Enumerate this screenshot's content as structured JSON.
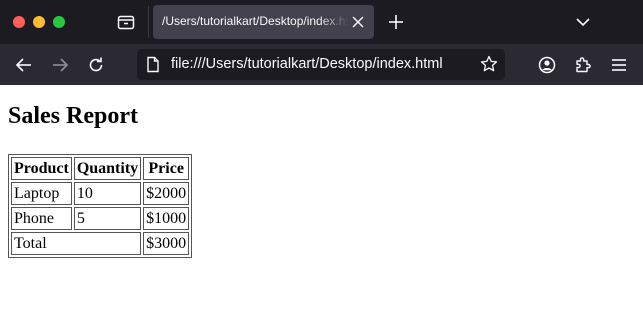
{
  "browser": {
    "tab": {
      "title": "/Users/tutorialkart/Desktop/index.html"
    },
    "url": "file:///Users/tutorialkart/Desktop/index.html"
  },
  "page": {
    "heading": "Sales Report",
    "table": {
      "headers": [
        "Product",
        "Quantity",
        "Price"
      ],
      "rows": [
        [
          "Laptop",
          "10",
          "$2000"
        ],
        [
          "Phone",
          "5",
          "$1000"
        ]
      ],
      "total": {
        "label": "Total",
        "value": "$3000"
      }
    }
  }
}
